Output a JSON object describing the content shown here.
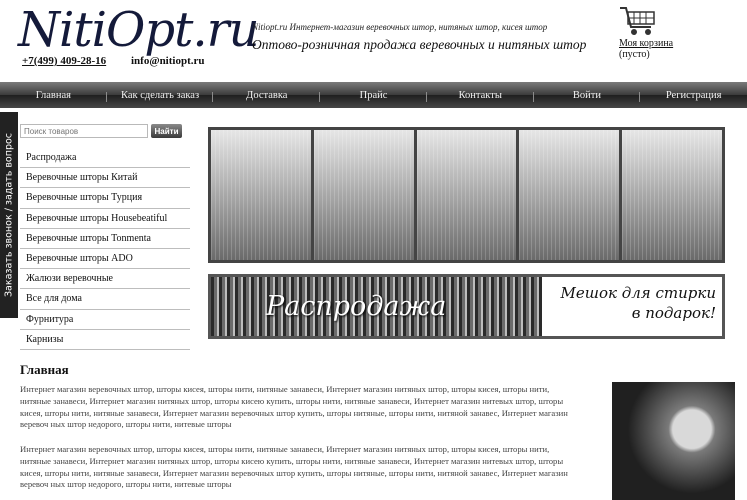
{
  "header": {
    "logo": "NitiOpt.ru",
    "phone": "+7(499) 409-28-16",
    "email": "info@nitiopt.ru",
    "tagline_small": "Nitiopt.ru Интернет-магазин веревочных штор, нитяных штор, кисея штор",
    "tagline_big": "Оптово-розничная продажа веревочных и нитяных штор",
    "cart_link": "Моя корзина",
    "cart_status": "(пусто)"
  },
  "nav": [
    "Главная",
    "Как сделать заказ",
    "Доставка",
    "Прайс",
    "Контакты",
    "Войти",
    "Регистрация"
  ],
  "callback_tab": "Заказать звонок / задать вопрос",
  "search": {
    "placeholder": "Поиск товаров",
    "button": "Найти"
  },
  "sidebar": [
    "Распродажа",
    "Веревочные шторы Китай",
    "Веревочные шторы Турция",
    "Веревочные шторы Housebeatiful",
    "Веревочные шторы Tonmenta",
    "Веревочные шторы ADO",
    "Жалюзи веревочные",
    "Все для дома",
    "Фурнитура",
    "Карнизы"
  ],
  "banner": {
    "sale_title": "Распродажа",
    "gift_line1": "Мешок для стирки",
    "gift_line2": "в подарок!"
  },
  "main": {
    "heading": "Главная",
    "paragraph1": "Интернет магазин веревочных штор, шторы кисея, шторы нити, нитяные занавеси, Интернет магазин нитяных штор, шторы кисея, шторы нити, нитяные занавеси, Интернет магазин нитяных штор, шторы кисею купить, шторы нити, нитяные занавеси, Интернет магазин нитевых штор, шторы кисея, шторы нити, нитяные занавеси, Интернет магазин веревочных штор купить, шторы нитяные, шторы нити, нитяной занавес, Интернет магазин веревоч ных штор недорого, шторы нити, нитевые шторы",
    "paragraph2": "Интернет магазин веревочных штор, шторы кисея, шторы нити, нитяные занавеси, Интернет магазин нитяных штор, шторы кисея, шторы нити, нитяные занавеси, Интернет магазин нитяных штор, шторы кисею купить, шторы нити, нитяные занавеси, Интернет магазин нитевых штор, шторы кисея, шторы нити, нитяные занавеси, Интернет магазин веревочных штор купить, шторы нитяные, шторы нити, нитяной занавес, Интернет магазин веревоч ных штор недорого, шторы нити, нитевые шторы"
  }
}
